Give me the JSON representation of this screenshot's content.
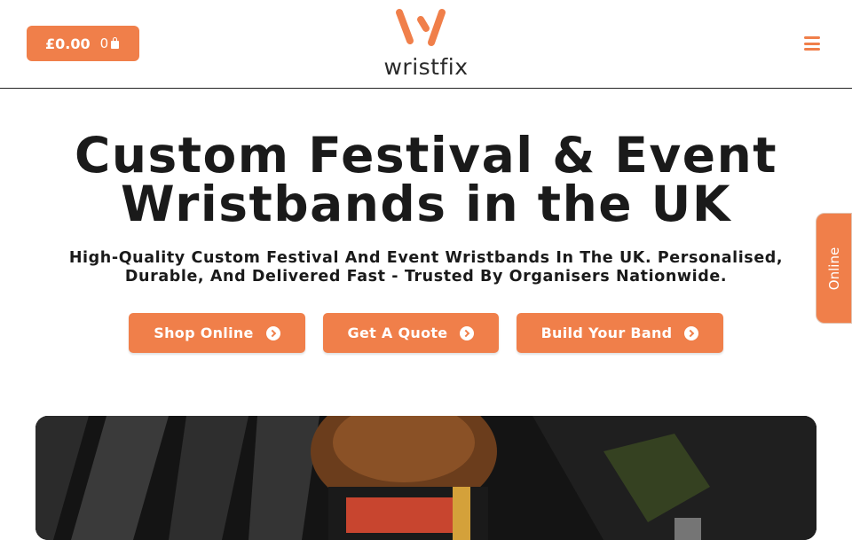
{
  "header": {
    "cart_total": "£0.00",
    "cart_count": "0",
    "logo_text": "wristfix"
  },
  "hero": {
    "title_line1": "Custom Festival & Event",
    "title_line2": "Wristbands in the UK",
    "subtitle_line1": "High-Quality Custom Festival And Event Wristbands In The UK. Personalised,",
    "subtitle_line2": "Durable, And Delivered Fast - Trusted By Organisers Nationwide."
  },
  "cta": [
    {
      "label": "Shop Online"
    },
    {
      "label": "Get A Quote"
    },
    {
      "label": "Build Your Band"
    }
  ],
  "online_tab": "Online",
  "colors": {
    "accent": "#f07f4a",
    "text": "#1a1a1a",
    "background": "#ffffff"
  },
  "icons": [
    "shopping-bag-icon",
    "wristfix-logo",
    "hamburger-menu-icon",
    "circle-arrow-right-icon"
  ]
}
